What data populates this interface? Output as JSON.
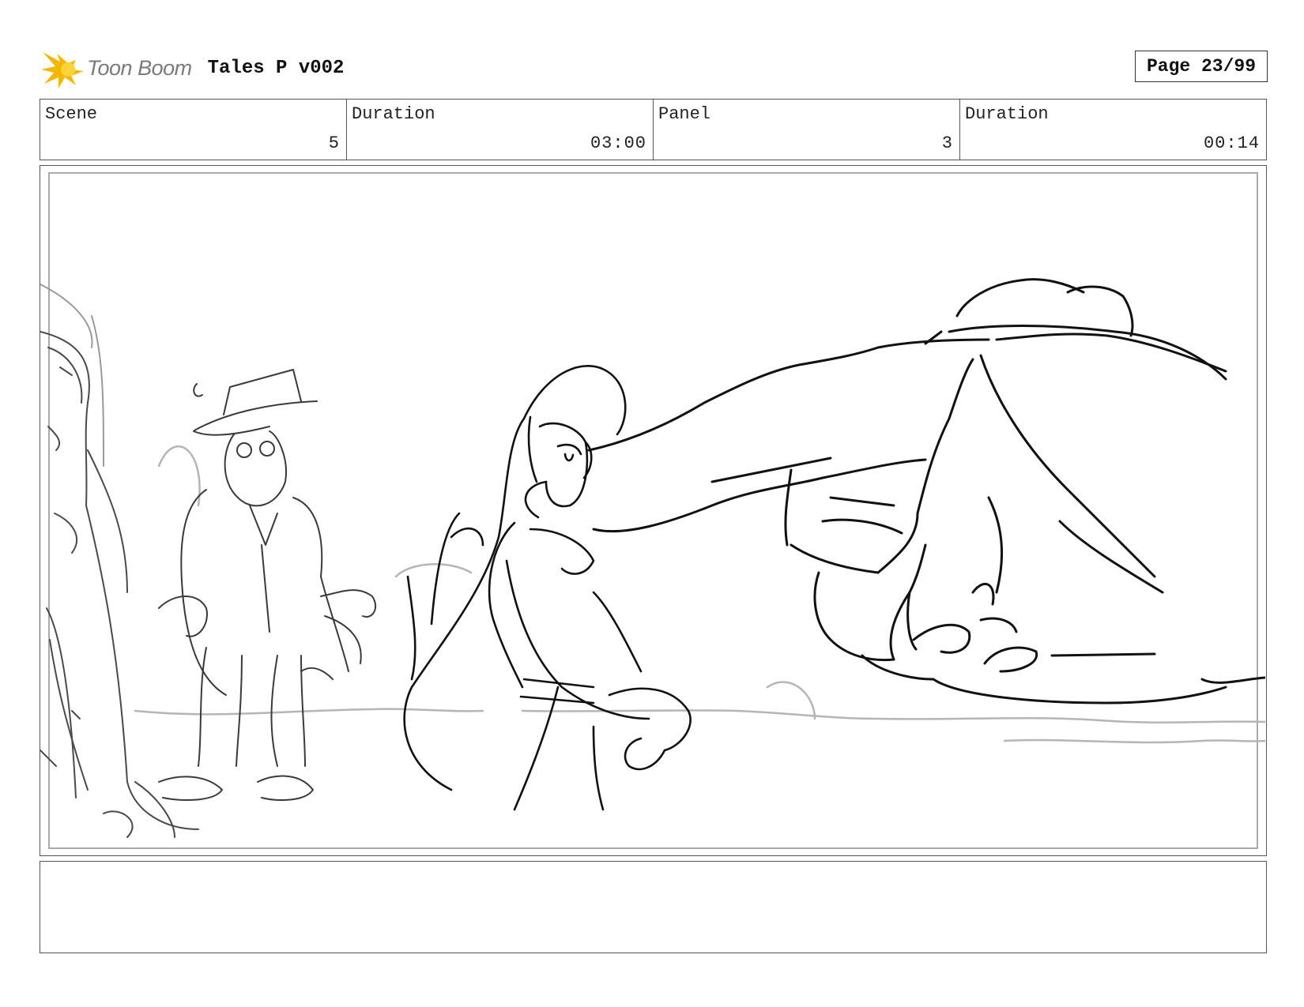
{
  "header": {
    "logo_text": "Toon Boom",
    "project_title": "Tales P v002",
    "page_label": "Page 23/99"
  },
  "info": [
    {
      "label": "Scene",
      "value": "5"
    },
    {
      "label": "Duration",
      "value": "03:00"
    },
    {
      "label": "Panel",
      "value": "3"
    },
    {
      "label": "Duration",
      "value": "00:14"
    }
  ],
  "notes": {
    "text": ""
  },
  "colors": {
    "logo_accent": "#f5b800",
    "line_art": "#111111",
    "rough_sketch": "#555555"
  }
}
